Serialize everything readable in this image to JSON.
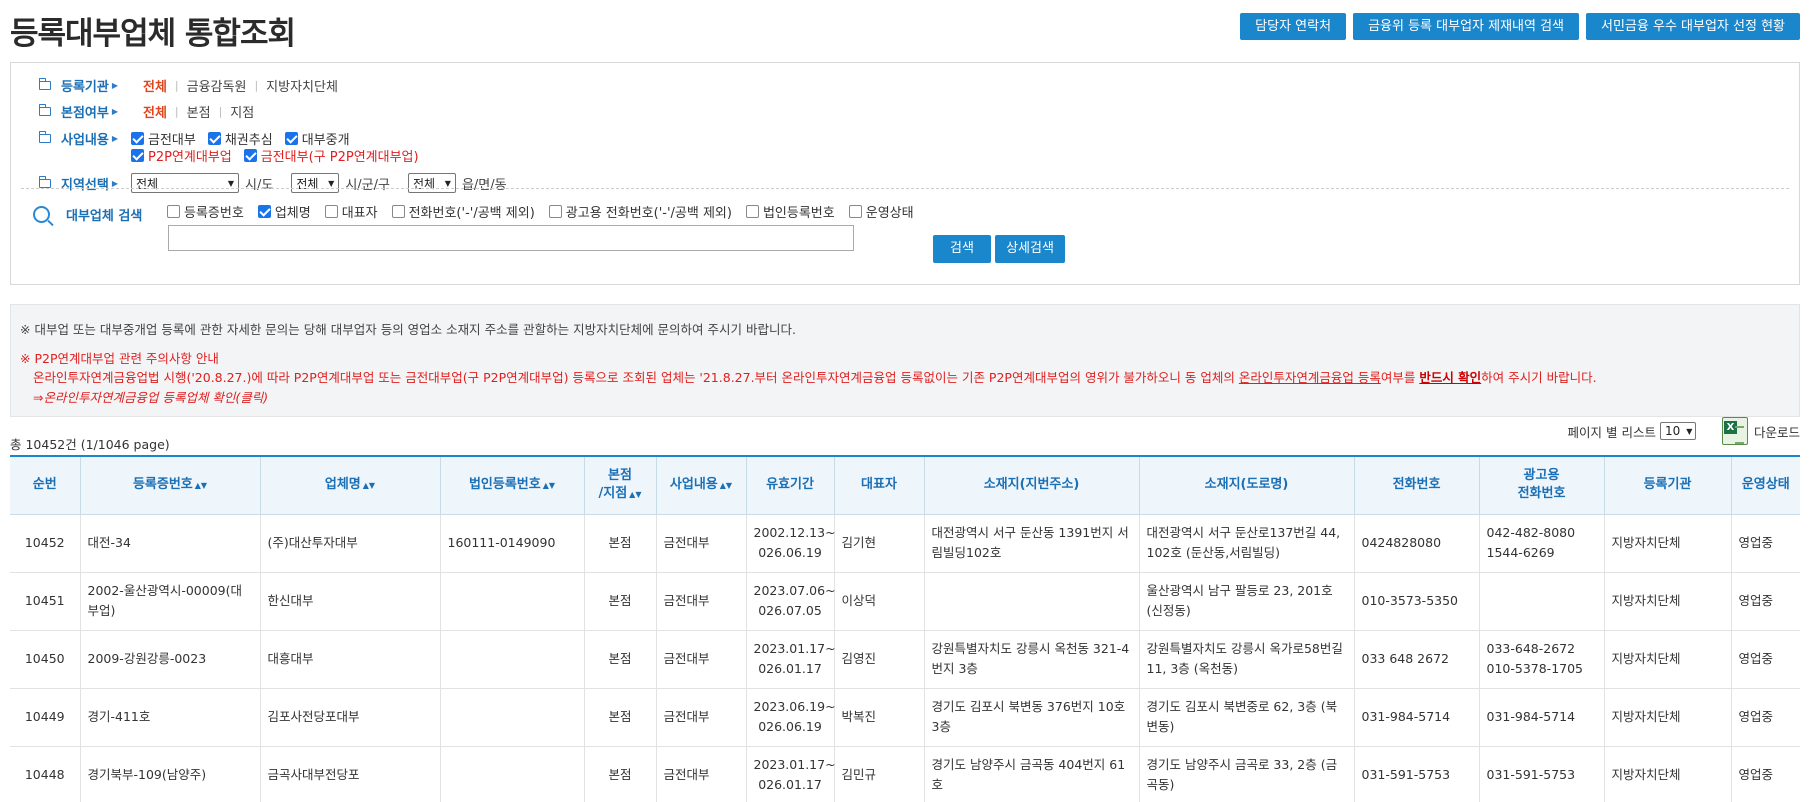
{
  "header": {
    "title": "등록대부업체 통합조회",
    "buttons": [
      "담당자 연락처",
      "금융위 등록 대부업자 제재내역 검색",
      "서민금융 우수 대부업자 선정 현황"
    ]
  },
  "filters": {
    "registrar": {
      "label": "등록기관",
      "options": [
        "전체",
        "금융감독원",
        "지방자치단체"
      ]
    },
    "branch": {
      "label": "본점여부",
      "options": [
        "전체",
        "본점",
        "지점"
      ]
    },
    "business": {
      "label": "사업내용",
      "options": [
        {
          "text": "금전대부",
          "checked": true,
          "red": false
        },
        {
          "text": "채권추심",
          "checked": true,
          "red": false
        },
        {
          "text": "대부중개",
          "checked": true,
          "red": false
        },
        {
          "text": "P2P연계대부업",
          "checked": true,
          "red": true
        },
        {
          "text": "금전대부(구 P2P연계대부업)",
          "checked": true,
          "red": true
        }
      ]
    },
    "region": {
      "label": "지역선택",
      "sido_value": "전체",
      "sido_label": "시/도",
      "sigungu_value": "전체",
      "sigungu_label": "시/군/구",
      "dong_value": "전체",
      "dong_label": "읍/면/동"
    },
    "search": {
      "label": "대부업체 검색",
      "options": [
        {
          "text": "등록증번호",
          "checked": false
        },
        {
          "text": "업체명",
          "checked": true
        },
        {
          "text": "대표자",
          "checked": false
        },
        {
          "text": "전화번호('-'/공백 제외)",
          "checked": false
        },
        {
          "text": "광고용 전화번호('-'/공백 제외)",
          "checked": false
        },
        {
          "text": "법인등록번호",
          "checked": false
        },
        {
          "text": "운영상태",
          "checked": false
        }
      ],
      "input_value": "",
      "search_btn": "검색",
      "detail_btn": "상세검색"
    }
  },
  "notice": {
    "line1": "※ 대부업 또는 대부중개업 등록에 관한 자세한 문의는 당해 대부업자 등의 영업소 소재지 주소를 관할하는 지방자치단체에 문의하여 주시기 바랍니다.",
    "line2": "※ P2P연계대부업 관련 주의사항 안내",
    "line3_a": "온라인투자연계금융업법 시행('20.8.27.)에 따라 P2P연계대부업 또는 금전대부업(구 P2P연계대부업) 등록으로 조회된 업체는 '21.8.27.부터 온라인투자연계금융업 등록없이는 기존 P2P연계대부업의 영위가 불가하오니 동 업체의 ",
    "line3_u": "온라인투자연계금융업 등록",
    "line3_b": "여부를 ",
    "line3_strong": "반드시 확인",
    "line3_c": "하여 주시기 바랍니다.",
    "line4": "⇒온라인투자연계금융업 등록업체 확인(클릭)"
  },
  "list": {
    "total": "총 10452건 (1/1046 page)",
    "per_page_label": "페이지 별 리스트",
    "per_page_value": "10",
    "download_label": "다운로드"
  },
  "table": {
    "headers": [
      "순번",
      "등록증번호",
      "업체명",
      "법인등록번호",
      "본점/지점",
      "사업내용",
      "유효기간",
      "대표자",
      "소재지(지번주소)",
      "소재지(도로명)",
      "전화번호",
      "광고용 전화번호",
      "등록기관",
      "운영상태"
    ],
    "rows": [
      [
        "10452",
        "대전-34",
        "(주)대산투자대부",
        "160111-0149090",
        "본점",
        "금전대부",
        "2002.12.13~2026.06.19",
        "김기현",
        "대전광역시 서구 둔산동 1391번지 서림빌딩102호",
        "대전광역시 서구 둔산로137번길 44, 102호 (둔산동,서림빌딩)",
        "0424828080",
        "042-482-8080\n1544-6269",
        "지방자치단체",
        "영업중"
      ],
      [
        "10451",
        "2002-울산광역시-00009(대부업)",
        "한신대부",
        "",
        "본점",
        "금전대부",
        "2023.07.06~2026.07.05",
        "이상덕",
        "",
        "울산광역시 남구 팔등로 23, 201호 (신정동)",
        "010-3573-5350",
        "",
        "지방자치단체",
        "영업중"
      ],
      [
        "10450",
        "2009-강원강릉-0023",
        "대흥대부",
        "",
        "본점",
        "금전대부",
        "2023.01.17~2026.01.17",
        "김영진",
        "강원특별자치도 강릉시 옥천동 321-4번지 3층",
        "강원특별자치도 강릉시 옥가로58번길 11, 3층 (옥천동)",
        "033 648 2672",
        "033-648-2672\n010-5378-1705",
        "지방자치단체",
        "영업중"
      ],
      [
        "10449",
        "경기-411호",
        "김포사전당포대부",
        "",
        "본점",
        "금전대부",
        "2023.06.19~2026.06.19",
        "박복진",
        "경기도 김포시 북변동 376번지 10호 3층",
        "경기도 김포시 북변중로 62, 3층 (북변동)",
        "031-984-5714",
        "031-984-5714",
        "지방자치단체",
        "영업중"
      ],
      [
        "10448",
        "경기북부-109(남양주)",
        "금곡사대부전당포",
        "",
        "본점",
        "금전대부",
        "2023.01.17~2026.01.17",
        "김민규",
        "경기도 남양주시 금곡동 404번지 61호",
        "경기도 남양주시 금곡로 33, 2층 (금곡동)",
        "031-591-5753",
        "031-591-5753",
        "지방자치단체",
        "영업중"
      ]
    ]
  },
  "colors": {
    "accent": "#1a86cc",
    "active": "#e0461e",
    "warning": "#e02020"
  }
}
